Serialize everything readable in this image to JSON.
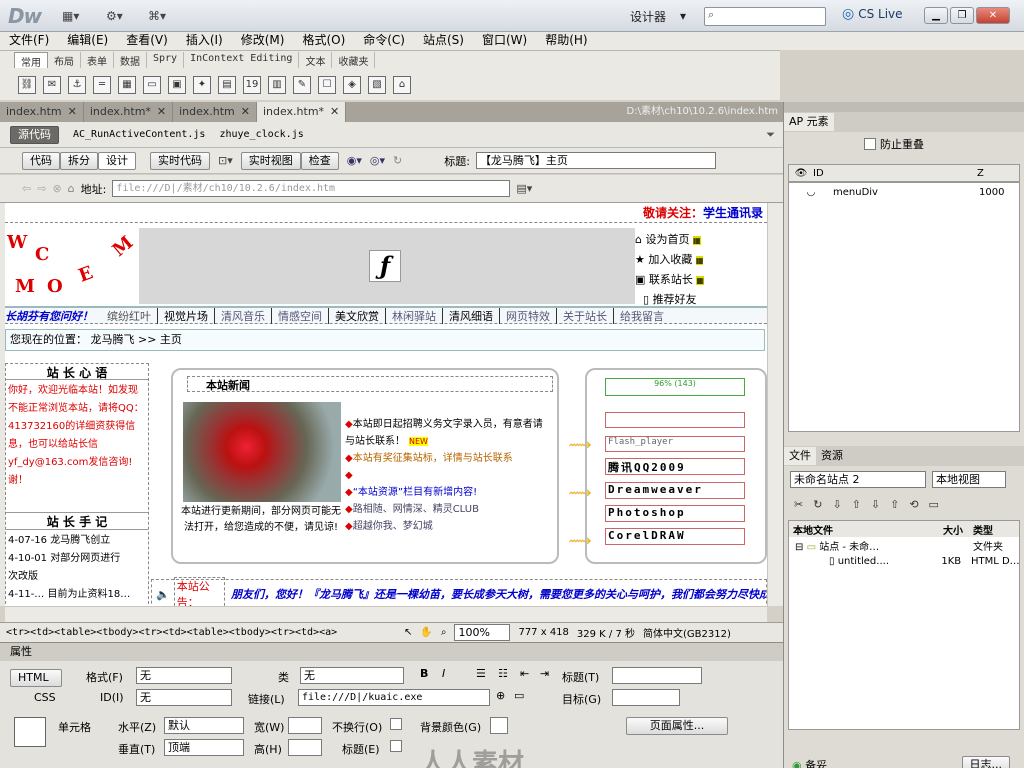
{
  "app": {
    "logo": "Dw",
    "workspace": "设计器",
    "search_placeholder": "",
    "cslive": "CS Live"
  },
  "menus": [
    "文件(F)",
    "编辑(E)",
    "查看(V)",
    "插入(I)",
    "修改(M)",
    "格式(O)",
    "命令(C)",
    "站点(S)",
    "窗口(W)",
    "帮助(H)"
  ],
  "insert_tabs": [
    "常用",
    "布局",
    "表单",
    "数据",
    "Spry",
    "InContext Editing",
    "文本",
    "收藏夹"
  ],
  "doc_tabs": [
    {
      "name": "index.htm"
    },
    {
      "name": "index.htm*"
    },
    {
      "name": "index.htm"
    },
    {
      "name": "index.htm*",
      "active": true
    }
  ],
  "doc_path": "D:\\素材\\ch10\\10.2.6\\index.htm",
  "related": {
    "source": "源代码",
    "files": [
      "AC_RunActiveContent.js",
      "zhuye_clock.js"
    ]
  },
  "view_buttons": [
    "代码",
    "拆分",
    "设计"
  ],
  "live_buttons": [
    "实时代码",
    "实时视图",
    "检查"
  ],
  "title_label": "标题:",
  "title_value": "【龙马腾飞】主页",
  "addr_label": "地址:",
  "addr_value": "file:///D|/素材/ch10/10.2.6/index.htm",
  "page": {
    "notice": "敬请关注：学生通讯录",
    "notice_a": "敬请关注：",
    "notice_b": "学生通讯录",
    "banner_letters": [
      "W",
      "C",
      "O",
      "E",
      "M",
      "M"
    ],
    "side_links": [
      "设为首页",
      "加入收藏",
      "联系站长",
      "推荐好友"
    ],
    "nav_greeting": "长胡芬有您问好！",
    "nav": [
      "缤纷红叶",
      "视觉片场",
      "清风音乐",
      "情感空间",
      "美文欣赏",
      "林闲驿站",
      "清风细语",
      "网页特效",
      "关于站长",
      "给我留言"
    ],
    "location": "您现在的位置：  龙马腾飞 >> 主页",
    "heart_title": "站 长 心 语",
    "heart_text": "你好，欢迎光临本站！如发现不能正常浏览本站，请将QQ：413732160的详细资获得信息，也可以给站长信yf_dy@163.com发信咨询!谢！",
    "notes_title": "站 长 手 记",
    "notes": [
      "4-07-16 龙马腾飞创立",
      "4-10-01 对部分网页进行",
      "次改版",
      "4-11-… 目前为止资料18…"
    ],
    "news_title": "本站新闻",
    "photo_caption": "本站进行更新期间，部分网页可能无法打开，给您造成的不便，请见谅!",
    "news_items": [
      "本站即日起招聘义务文字录入员，有意者请与站长联系！",
      "本站有奖征集站标，详情与站长联系",
      "",
      "“本站资源”栏目有新增内容!",
      "路相随、网情深、精灵CLUB",
      "超越你我、梦幻城"
    ],
    "new_badge": "NEW",
    "slider_label": "96% (143)",
    "flash_label": "Flash_player",
    "links": [
      "腾讯QQ2009",
      "Dreamweaver",
      "Photoshop",
      "CorelDRAW"
    ],
    "announce_label": "本站公告：",
    "announce": "朋友们，您好！『龙马腾飞』还是一棵幼苗，要长成参天大树，需要您更多的关心与呵护，我们都会努力尽快成长，让我们一起见证。"
  },
  "status": {
    "tags": "<tr><td><table><tbody><tr><td><table><tbody><tr><td><a>",
    "zoom": "100%",
    "size": "777 x 418",
    "weight": "329 K / 7 秒",
    "encoding": "简体中文(GB2312)"
  },
  "props": {
    "title": "属性",
    "html": "HTML",
    "css": "CSS",
    "format_label": "格式(F)",
    "format_val": "无",
    "class_label": "类",
    "class_val": "无",
    "id_label": "ID(I)",
    "id_val": "无",
    "link_label": "链接(L)",
    "link_val": "file:///D|/kuaic.exe",
    "title_label": "标题(T)",
    "target_label": "目标(G)",
    "cell_label": "单元格",
    "halign_label": "水平(Z)",
    "halign_val": "默认",
    "valign_label": "垂直(T)",
    "valign_val": "顶端",
    "width_label": "宽(W)",
    "height_label": "高(H)",
    "nowrap_label": "不换行(O)",
    "header_label": "标题(E)",
    "bg_label": "背景颜色(G)",
    "page_props": "页面属性..."
  },
  "ap": {
    "tab": "AP 元素",
    "prevent_overlap": "防止重叠",
    "col_id": "ID",
    "col_z": "Z",
    "row_id": "menuDiv",
    "row_z": "1000"
  },
  "files": {
    "tab1": "文件",
    "tab2": "资源",
    "site": "未命名站点 2",
    "view": "本地视图",
    "col_local": "本地文件",
    "col_size": "大小",
    "col_type": "类型",
    "row1_name": "站点 - 未命…",
    "row1_type": "文件夹",
    "row2_name": "untitled....",
    "row2_size": "1KB",
    "row2_type": "HTML D…",
    "log": "日志...",
    "ready": "备妥"
  },
  "watermark": "人人素材"
}
